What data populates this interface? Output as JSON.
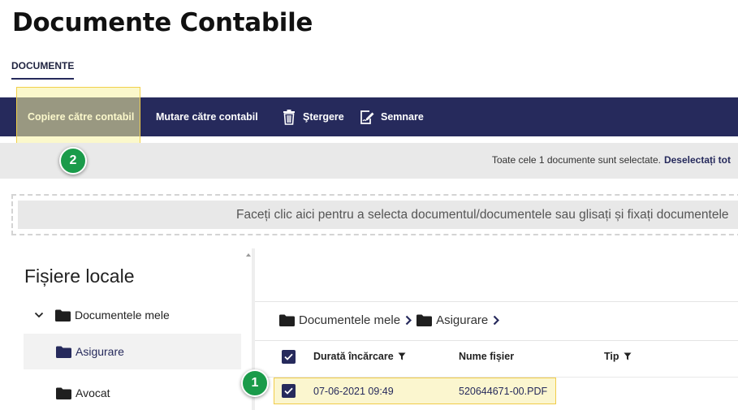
{
  "page": {
    "title": "Documente Contabile"
  },
  "tabs": [
    {
      "label": "DOCUMENTE",
      "active": true
    }
  ],
  "toolbar": {
    "copy_label": "Copiere către contabil",
    "move_label": "Mutare către contabil",
    "delete_label": "Ştergere",
    "sign_label": "Semnare",
    "delete_icon": "trash-icon",
    "sign_icon": "sign-document-icon"
  },
  "selection": {
    "text": "Toate cele 1 documente sunt selectate.",
    "deselect_label": "Deselectați tot"
  },
  "dropzone": {
    "text": "Faceți clic aici pentru a selecta documentul/documentele sau glisați și fixați documentele"
  },
  "sidebar": {
    "title": "Fișiere locale",
    "items": [
      {
        "label": "Documentele mele",
        "expanded": true
      },
      {
        "label": "Asigurare",
        "selected": true
      },
      {
        "label": "Avocat"
      }
    ]
  },
  "breadcrumb": [
    "Documentele mele",
    "Asigurare"
  ],
  "table": {
    "columns": {
      "date": "Durată încărcare",
      "name": "Nume fișier",
      "type": "Tip"
    },
    "rows": [
      {
        "date": "07-06-2021 09:49",
        "name": "520644671-00.PDF",
        "checked": true
      }
    ]
  },
  "annotations": {
    "step1": "1",
    "step2": "2"
  },
  "colors": {
    "navy": "#262a5c",
    "highlight": "#f2d04a",
    "badge": "#1a9b4a"
  }
}
